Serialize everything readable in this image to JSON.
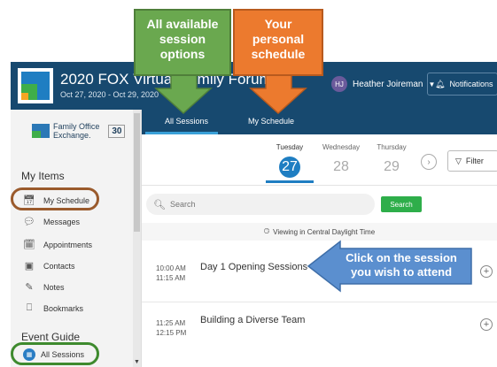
{
  "header": {
    "event_title": "2020 FOX Virtual Family Forum",
    "event_dates": "Oct 27, 2020 - Oct 29, 2020",
    "user_initials": "HJ",
    "user_name": "Heather Joireman",
    "notifications_label": "Notifications"
  },
  "sidebar": {
    "logo_line1": "Family Office",
    "logo_line2": "Exchange.",
    "logo_badge": "30",
    "my_items_title": "My Items",
    "my_items": [
      "My Schedule",
      "Messages",
      "Appointments",
      "Contacts",
      "Notes",
      "Bookmarks"
    ],
    "event_guide_title": "Event Guide",
    "event_guide_items": [
      "All Sessions"
    ]
  },
  "tabs": [
    "All Sessions",
    "My Schedule"
  ],
  "days": [
    {
      "name": "Tuesday",
      "num": "27"
    },
    {
      "name": "Wednesday",
      "num": "28"
    },
    {
      "name": "Thursday",
      "num": "29"
    }
  ],
  "filter_label": "Filter",
  "search": {
    "placeholder": "Search",
    "button": "Search"
  },
  "timezone": "Viewing in Central Daylight Time",
  "sessions": [
    {
      "start": "10:00 AM",
      "end": "11:15 AM",
      "title": "Day 1 Opening Sessions"
    },
    {
      "start": "11:25 AM",
      "end": "12:15 PM",
      "title": "Building a Diverse Team"
    }
  ],
  "callouts": {
    "green": [
      "All available",
      "session",
      "options"
    ],
    "orange": [
      "Your",
      "personal",
      "schedule"
    ],
    "blue": [
      "Click on the session",
      "you wish to attend"
    ]
  },
  "colors": {
    "header_bg": "#17496f",
    "accent_blue": "#1f7ec2",
    "search_green": "#2eae4a",
    "callout_green": "#6aa84f",
    "callout_orange": "#ec7a2e",
    "callout_blue": "#5b8fcf"
  }
}
